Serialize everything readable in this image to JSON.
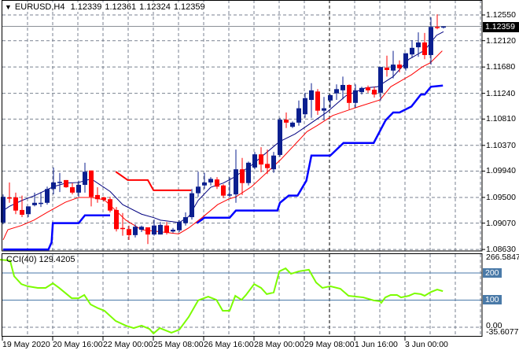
{
  "header": {
    "menu_icon": "triangle-down-icon",
    "symbol": "EURUSD,H4",
    "open": "1.12339",
    "high": "1.12361",
    "low": "1.12324",
    "close": "1.12359"
  },
  "price_axis": [
    "1.12550",
    "1.12120",
    "1.11680",
    "1.11240",
    "1.10810",
    "1.10370",
    "1.09940",
    "1.09500",
    "1.09070",
    "1.08630"
  ],
  "current_price": "1.12359",
  "cci_header": "CCI(40) 129.4205",
  "cci_axis": {
    "max": "266.5847",
    "l200": "200",
    "l100": "100",
    "zero": "0.00",
    "min": "-35.6077"
  },
  "time_labels": [
    "19 May 2020",
    "20 May 16:00",
    "22 May 00:00",
    "25 May 08:00",
    "26 May 16:00",
    "28 May 00:00",
    "29 May 08:00",
    "1 Jun 16:00",
    "3 Jun 00:00"
  ],
  "colors": {
    "bull": "#0b1f8f",
    "bear": "#ff0000",
    "ma_fast": "#000080",
    "ma_slow": "#ff0000",
    "band_low": "#0000ff",
    "band_high": "#ff0000",
    "cci": "#7cfc00",
    "level": "#4a7aa8"
  },
  "chart_data": [
    {
      "type": "candlestick",
      "title": "EURUSD,H4",
      "ylim": [
        1.0863,
        1.1255
      ],
      "candles_ohlc": [
        [
          1.0908,
          1.0955,
          1.0905,
          1.0951
        ],
        [
          1.095,
          1.0975,
          1.0941,
          1.0949
        ],
        [
          1.095,
          1.0958,
          1.0922,
          1.0928
        ],
        [
          1.0929,
          1.0953,
          1.0917,
          1.0921
        ],
        [
          1.0922,
          1.0935,
          1.0917,
          1.0935
        ],
        [
          1.0937,
          1.0958,
          1.0935,
          1.0941
        ],
        [
          1.0939,
          1.0959,
          1.0934,
          1.0941
        ],
        [
          1.0941,
          1.0968,
          1.0938,
          1.0964
        ],
        [
          1.0964,
          1.1,
          1.0955,
          1.0975
        ],
        [
          1.0974,
          1.0991,
          1.0959,
          1.0976
        ],
        [
          1.0979,
          1.0979,
          1.0966,
          1.0967
        ],
        [
          1.0967,
          1.0974,
          1.0955,
          1.0958
        ],
        [
          1.0958,
          1.0978,
          1.0951,
          1.0971
        ],
        [
          1.0971,
          1.1008,
          1.0958,
          1.0993
        ],
        [
          1.0995,
          1.0995,
          1.0935,
          1.0951
        ],
        [
          1.0954,
          1.0967,
          1.0941,
          1.0947
        ],
        [
          1.095,
          1.0951,
          1.0943,
          1.0946
        ],
        [
          1.0947,
          1.0951,
          1.0925,
          1.0928
        ],
        [
          1.0929,
          1.0934,
          1.0893,
          1.0897
        ],
        [
          1.0899,
          1.0924,
          1.0886,
          1.0897
        ],
        [
          1.0897,
          1.0903,
          1.0879,
          1.0887
        ],
        [
          1.0887,
          1.0905,
          1.0883,
          1.0901
        ],
        [
          1.0896,
          1.0903,
          1.0892,
          1.0901
        ],
        [
          1.09,
          1.09,
          1.0872,
          1.0888
        ],
        [
          1.0888,
          1.0913,
          1.0886,
          1.0903
        ],
        [
          1.0888,
          1.0909,
          1.0888,
          1.0904
        ],
        [
          1.0903,
          1.0909,
          1.0888,
          1.0891
        ],
        [
          1.0893,
          1.0899,
          1.0891,
          1.0896
        ],
        [
          1.0895,
          1.0912,
          1.0892,
          1.0909
        ],
        [
          1.0907,
          1.0925,
          1.0903,
          1.0917
        ],
        [
          1.0917,
          1.0964,
          1.0913,
          1.0957
        ],
        [
          1.0957,
          1.0993,
          1.0951,
          1.0968
        ],
        [
          1.097,
          1.0991,
          1.0964,
          1.0975
        ],
        [
          1.0975,
          1.0984,
          1.097,
          1.0981
        ],
        [
          1.098,
          1.0984,
          1.0964,
          1.0968
        ],
        [
          1.097,
          1.0972,
          1.0949,
          1.0953
        ],
        [
          1.0953,
          1.0984,
          1.0951,
          1.0955
        ],
        [
          1.0955,
          1.103,
          1.0941,
          1.0997
        ],
        [
          1.0997,
          1.1016,
          1.0954,
          1.0974
        ],
        [
          1.0974,
          1.101,
          1.097,
          1.1008
        ],
        [
          1.1,
          1.1026,
          1.0997,
          1.1022
        ],
        [
          1.1022,
          1.1034,
          1.0992,
          1.1005
        ],
        [
          1.1006,
          1.103,
          1.0989,
          1.0999
        ],
        [
          1.0997,
          1.1026,
          1.0991,
          1.102
        ],
        [
          1.1021,
          1.1083,
          1.1018,
          1.108
        ],
        [
          1.108,
          1.1092,
          1.1066,
          1.1075
        ],
        [
          1.1068,
          1.1077,
          1.1066,
          1.1075
        ],
        [
          1.1075,
          1.1112,
          1.107,
          1.1099
        ],
        [
          1.1089,
          1.1125,
          1.1083,
          1.1116
        ],
        [
          1.1113,
          1.1141,
          1.1083,
          1.1129
        ],
        [
          1.1127,
          1.1131,
          1.1088,
          1.1095
        ],
        [
          1.1095,
          1.1118,
          1.1079,
          1.1099
        ],
        [
          1.1112,
          1.1122,
          1.11,
          1.1121
        ],
        [
          1.1124,
          1.1139,
          1.1113,
          1.1131
        ],
        [
          1.1129,
          1.1152,
          1.1114,
          1.1138
        ],
        [
          1.1138,
          1.1139,
          1.1097,
          1.1108
        ],
        [
          1.1108,
          1.1139,
          1.11,
          1.1129
        ],
        [
          1.1126,
          1.1135,
          1.1122,
          1.1133
        ],
        [
          1.1134,
          1.1137,
          1.1125,
          1.1129
        ],
        [
          1.113,
          1.1135,
          1.1117,
          1.1122
        ],
        [
          1.1125,
          1.1168,
          1.1112,
          1.1168
        ],
        [
          1.1167,
          1.1187,
          1.1152,
          1.1163
        ],
        [
          1.1162,
          1.1195,
          1.1149,
          1.1172
        ],
        [
          1.1172,
          1.1179,
          1.1159,
          1.1166
        ],
        [
          1.1166,
          1.1191,
          1.1162,
          1.1191
        ],
        [
          1.1189,
          1.1213,
          1.1183,
          1.12
        ],
        [
          1.1201,
          1.1226,
          1.1185,
          1.1209
        ],
        [
          1.1209,
          1.1225,
          1.1181,
          1.1188
        ],
        [
          1.1188,
          1.1251,
          1.1172,
          1.1235
        ],
        [
          1.1235,
          1.1256,
          1.1231,
          1.1234
        ],
        [
          1.12339,
          1.12361,
          1.12324,
          1.12359
        ]
      ],
      "ma_fast": [
        [
          0,
          1.0928
        ],
        [
          1,
          1.0935
        ],
        [
          3,
          1.0945
        ],
        [
          5,
          1.0953
        ],
        [
          8,
          1.0968
        ],
        [
          10,
          1.0974
        ],
        [
          12,
          1.0975
        ],
        [
          14,
          1.0981
        ],
        [
          17,
          1.096
        ],
        [
          19,
          1.0938
        ],
        [
          22,
          1.0922
        ],
        [
          24,
          1.0916
        ],
        [
          25,
          1.0912
        ],
        [
          28,
          1.0908
        ],
        [
          29.5,
          1.0918
        ],
        [
          31,
          1.0945
        ],
        [
          33,
          1.0967
        ],
        [
          35,
          1.0974
        ],
        [
          36.6,
          1.0983
        ],
        [
          39.5,
          1.1004
        ],
        [
          43.9,
          1.1043
        ],
        [
          46.4,
          1.1056
        ],
        [
          48.9,
          1.1074
        ],
        [
          51.4,
          1.1092
        ],
        [
          54.5,
          1.112
        ],
        [
          57.6,
          1.1133
        ],
        [
          59.5,
          1.1135
        ],
        [
          62,
          1.1152
        ],
        [
          64.5,
          1.1181
        ],
        [
          67,
          1.1196
        ],
        [
          68.9,
          1.1221
        ],
        [
          70,
          1.1227
        ]
      ],
      "ma_slow": [
        [
          0,
          1.0879
        ],
        [
          0.75,
          1.0896
        ],
        [
          2.9,
          1.0903
        ],
        [
          4.9,
          1.0912
        ],
        [
          7,
          1.0925
        ],
        [
          9.9,
          1.0942
        ],
        [
          12,
          1.095
        ],
        [
          14.1,
          1.095
        ],
        [
          16.1,
          1.0946
        ],
        [
          17.9,
          1.0928
        ],
        [
          19.5,
          1.0912
        ],
        [
          22,
          1.0896
        ],
        [
          25.4,
          1.0892
        ],
        [
          27.9,
          1.0889
        ],
        [
          29.5,
          1.0899
        ],
        [
          31.6,
          1.0916
        ],
        [
          34.1,
          1.0938
        ],
        [
          35.8,
          1.0947
        ],
        [
          37,
          1.0951
        ],
        [
          39.5,
          1.0968
        ],
        [
          44.1,
          1.1013
        ],
        [
          48.3,
          1.106
        ],
        [
          49.9,
          1.107
        ],
        [
          52.4,
          1.1087
        ],
        [
          54.9,
          1.1096
        ],
        [
          56.6,
          1.1102
        ],
        [
          59.9,
          1.1113
        ],
        [
          61.6,
          1.1135
        ],
        [
          64.9,
          1.1155
        ],
        [
          66.6,
          1.1168
        ],
        [
          67.9,
          1.1175
        ],
        [
          69.8,
          1.1195
        ]
      ],
      "band_low": [
        [
          [
            0,
            1.0863
          ],
          [
            7.2,
            1.0863
          ],
          [
            7.7,
            1.0875
          ],
          [
            7.9,
            1.0907
          ],
          [
            12,
            1.0907
          ],
          [
            13,
            1.092
          ],
          [
            17,
            1.092
          ]
        ],
        [
          [
            30.8,
            1.0907
          ],
          [
            32,
            1.0916
          ],
          [
            36,
            1.0916
          ],
          [
            37,
            1.0928
          ],
          [
            43.6,
            1.0928
          ],
          [
            44,
            1.0941
          ],
          [
            45.4,
            1.0953
          ],
          [
            46.8,
            1.0953
          ],
          [
            48.2,
            1.0978
          ],
          [
            49,
            1.102
          ],
          [
            52,
            1.102
          ],
          [
            54.1,
            1.1041
          ],
          [
            58.9,
            1.1041
          ],
          [
            60.8,
            1.1079
          ],
          [
            62,
            1.1092
          ],
          [
            63,
            1.1092
          ],
          [
            64.9,
            1.1102
          ],
          [
            66.4,
            1.1122
          ],
          [
            67,
            1.1122
          ],
          [
            68,
            1.1135
          ],
          [
            69.9,
            1.1137
          ]
        ]
      ],
      "band_high": [
        [
          [
            17.9,
            1.0993
          ],
          [
            19.8,
            1.0979
          ],
          [
            23,
            1.0979
          ],
          [
            23.9,
            1.0962
          ],
          [
            29.9,
            1.0962
          ]
        ]
      ]
    },
    {
      "type": "line",
      "title": "CCI(40)",
      "ylim": [
        -35.6077,
        266.5847
      ],
      "levels": [
        200,
        100,
        0
      ],
      "values": [
        [
          -0.5,
          249
        ],
        [
          1.1,
          246
        ],
        [
          1.75,
          188
        ],
        [
          2.9,
          159
        ],
        [
          3.9,
          151
        ],
        [
          5.5,
          145
        ],
        [
          6.75,
          145
        ],
        [
          7.9,
          162
        ],
        [
          8.9,
          145
        ],
        [
          10.9,
          107
        ],
        [
          12,
          107
        ],
        [
          12.9,
          119
        ],
        [
          13.9,
          84
        ],
        [
          15.1,
          70
        ],
        [
          16.1,
          61
        ],
        [
          17.9,
          23
        ],
        [
          19.5,
          6
        ],
        [
          20.75,
          -3
        ],
        [
          22,
          6
        ],
        [
          23.25,
          -6
        ],
        [
          23.9,
          -23
        ],
        [
          24.9,
          -3
        ],
        [
          26.75,
          -20
        ],
        [
          28,
          -9
        ],
        [
          29.5,
          38
        ],
        [
          31,
          99
        ],
        [
          32.6,
          113
        ],
        [
          33.9,
          101
        ],
        [
          34.9,
          61
        ],
        [
          36,
          61
        ],
        [
          36.9,
          116
        ],
        [
          37.9,
          101
        ],
        [
          38.6,
          119
        ],
        [
          39.9,
          159
        ],
        [
          41,
          145
        ],
        [
          41.9,
          122
        ],
        [
          43,
          128
        ],
        [
          43.9,
          206
        ],
        [
          44.9,
          217
        ],
        [
          45.75,
          197
        ],
        [
          47,
          206
        ],
        [
          48.6,
          212
        ],
        [
          49.75,
          165
        ],
        [
          50.75,
          145
        ],
        [
          52,
          151
        ],
        [
          53.6,
          142
        ],
        [
          54.9,
          116
        ],
        [
          57.25,
          110
        ],
        [
          58.9,
          99
        ],
        [
          59.9,
          96
        ],
        [
          60.1,
          90
        ],
        [
          60.75,
          110
        ],
        [
          61.6,
          119
        ],
        [
          62.6,
          119
        ],
        [
          63.25,
          110
        ],
        [
          64.5,
          116
        ],
        [
          65.4,
          125
        ],
        [
          66.4,
          122
        ],
        [
          67,
          116
        ],
        [
          68,
          130
        ],
        [
          69,
          139
        ],
        [
          69.9,
          133
        ]
      ]
    }
  ]
}
